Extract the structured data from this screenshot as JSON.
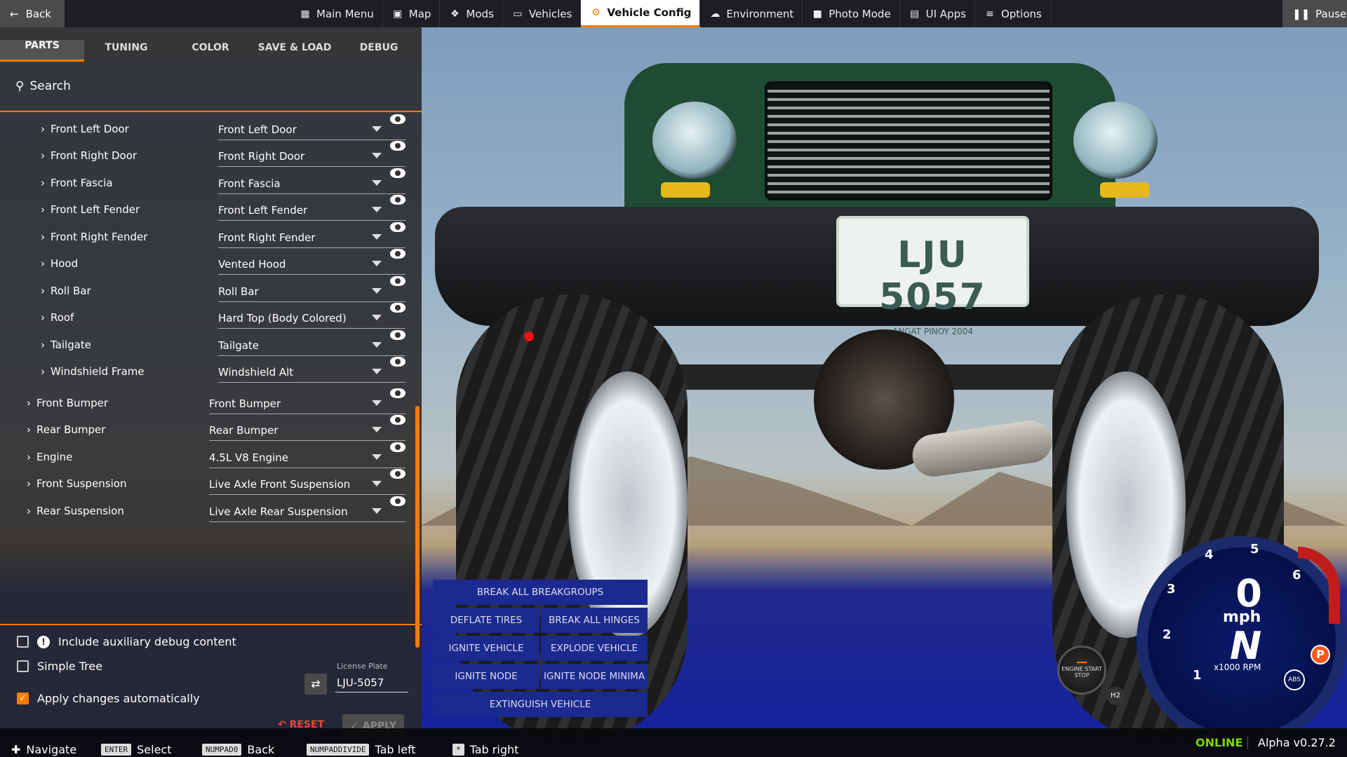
{
  "topbar": {
    "back_label": "Back",
    "pause_label": "Pause",
    "menu": [
      {
        "label": "Main Menu",
        "icon": "grid-icon"
      },
      {
        "label": "Map",
        "icon": "map-icon"
      },
      {
        "label": "Mods",
        "icon": "puzzle-icon"
      },
      {
        "label": "Vehicles",
        "icon": "car-icon"
      },
      {
        "label": "Vehicle Config",
        "icon": "engine-icon",
        "active": true
      },
      {
        "label": "Environment",
        "icon": "weather-icon"
      },
      {
        "label": "Photo Mode",
        "icon": "camera-icon"
      },
      {
        "label": "UI Apps",
        "icon": "apps-icon"
      },
      {
        "label": "Options",
        "icon": "sliders-icon"
      }
    ]
  },
  "panel": {
    "tabs": [
      "PARTS",
      "TUNING",
      "COLOR",
      "SAVE & LOAD",
      "DEBUG"
    ],
    "active_tab": "PARTS",
    "search_label": "Search",
    "parts": [
      {
        "name": "Front Left Door",
        "value": "Front Left Door",
        "indent": 2
      },
      {
        "name": "Front Right Door",
        "value": "Front Right Door",
        "indent": 2
      },
      {
        "name": "Front Fascia",
        "value": "Front Fascia",
        "indent": 2
      },
      {
        "name": "Front Left Fender",
        "value": "Front Left Fender",
        "indent": 2
      },
      {
        "name": "Front Right Fender",
        "value": "Front Right Fender",
        "indent": 2
      },
      {
        "name": "Hood",
        "value": "Vented Hood",
        "indent": 2
      },
      {
        "name": "Roll Bar",
        "value": "Roll Bar",
        "indent": 2
      },
      {
        "name": "Roof",
        "value": "Hard Top (Body Colored)",
        "indent": 2
      },
      {
        "name": "Tailgate",
        "value": "Tailgate",
        "indent": 2
      },
      {
        "name": "Windshield Frame",
        "value": "Windshield Alt",
        "indent": 2
      },
      {
        "name": "Front Bumper",
        "value": "Front Bumper",
        "indent": 1
      },
      {
        "name": "Rear Bumper",
        "value": "Rear Bumper",
        "indent": 1
      },
      {
        "name": "Engine",
        "value": "4.5L V8 Engine",
        "indent": 1
      },
      {
        "name": "Front Suspension",
        "value": "Live Axle Front Suspension",
        "indent": 1
      },
      {
        "name": "Rear Suspension",
        "value": "Live Axle Rear Suspension",
        "indent": 1
      }
    ],
    "options": {
      "aux_debug": "Include auxiliary debug content",
      "simple_tree": "Simple Tree",
      "apply_auto": "Apply changes automatically"
    },
    "license_plate_label": "License Plate",
    "license_plate_value": "LJU-5057",
    "reset_label": "RESET",
    "apply_label": "APPLY"
  },
  "actions": [
    {
      "label": "BREAK ALL BREAKGROUPS",
      "span": 2
    },
    {
      "label": "DEFLATE TIRES",
      "span": 1
    },
    {
      "label": "BREAK ALL HINGES",
      "span": 1
    },
    {
      "label": "IGNITE VEHICLE",
      "span": 1
    },
    {
      "label": "EXPLODE VEHICLE",
      "span": 1
    },
    {
      "label": "IGNITE NODE",
      "span": 1
    },
    {
      "label": "IGNITE NODE MINIMA",
      "span": 1
    },
    {
      "label": "EXTINGUISH VEHICLE",
      "span": 2
    }
  ],
  "scene": {
    "plate_text": "LJU 5057",
    "plate_sub": "ANGAT PINOY 2004"
  },
  "dash": {
    "speed": "0",
    "speed_unit": "mph",
    "gear": "N",
    "rpm_unit": "x1000 RPM",
    "rpm_ticks": [
      "1",
      "2",
      "3",
      "4",
      "5",
      "6"
    ],
    "park": "P",
    "abs": "ABS",
    "engine_btn": "ENGINE START STOP",
    "h2": "H2"
  },
  "bottombar": {
    "hints": [
      {
        "key": "",
        "label": "Navigate"
      },
      {
        "key": "ENTER",
        "label": "Select"
      },
      {
        "key": "NUMPAD0",
        "label": "Back"
      },
      {
        "key": "NUMPADDIVIDE",
        "label": "Tab left"
      },
      {
        "key": "*",
        "label": "Tab right"
      }
    ],
    "status": "ONLINE",
    "version": "Alpha v0.27.2"
  },
  "colors": {
    "accent": "#ff7b00",
    "online": "#7cd600",
    "reset": "#e5473a",
    "action_bg": "#1a2a8f"
  }
}
